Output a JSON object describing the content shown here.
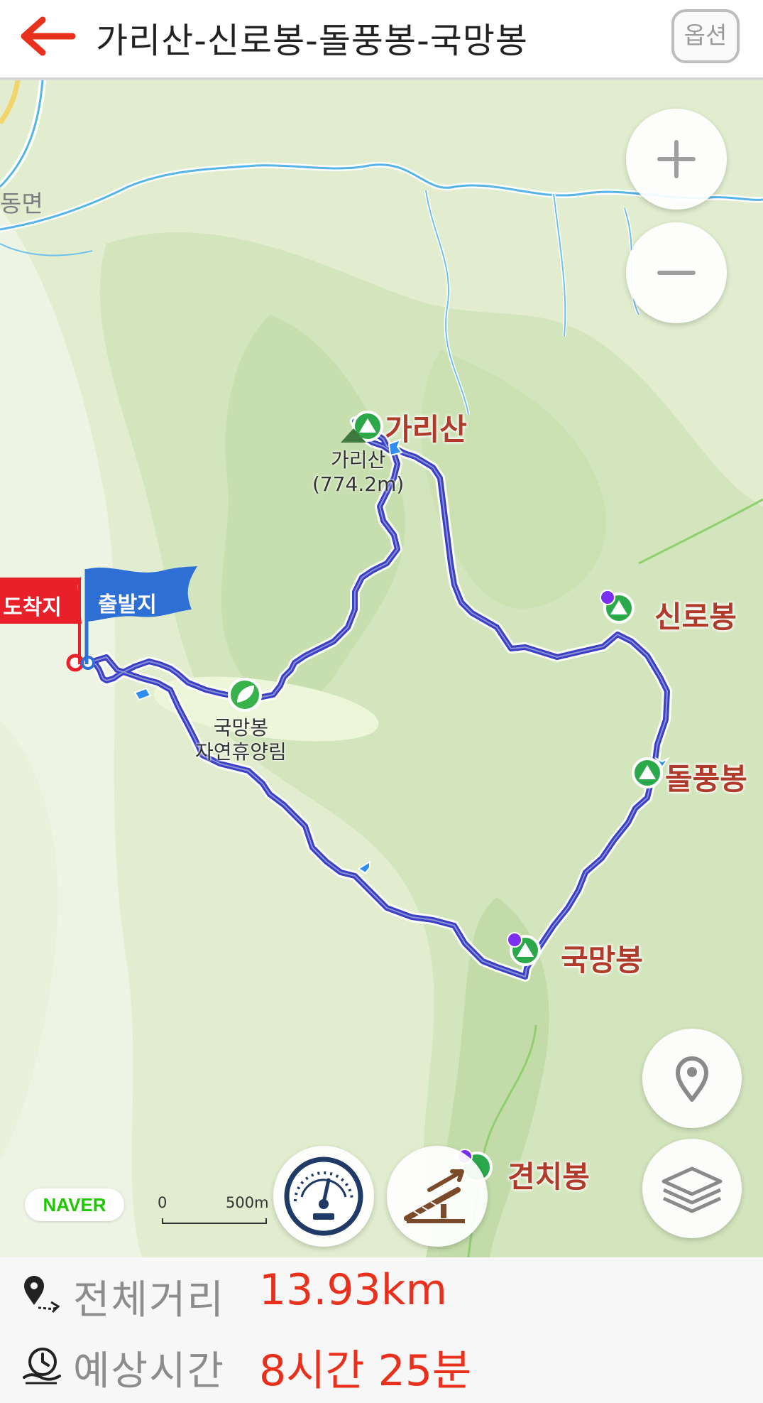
{
  "header": {
    "title": "가리산-신로봉-돌풍봉-국망봉",
    "option_label": "옵션"
  },
  "map": {
    "town_label": "동면",
    "peaks": [
      {
        "label": "가리산"
      },
      {
        "label": "신로봉"
      },
      {
        "label": "돌풍봉"
      },
      {
        "label": "국망봉"
      },
      {
        "label": "견치봉"
      }
    ],
    "summit_name": "가리산",
    "summit_elevation": "(774.2m)",
    "forest_label_line1": "국망봉",
    "forest_label_line2": "자연휴양림",
    "flag_end": "도착지",
    "flag_start": "출발지",
    "logo": "NAVER",
    "scale_start": "0",
    "scale_end": "500m",
    "colors": {
      "route": "#3b3fc6",
      "peak_label": "#b03b2a",
      "flag_end": "#e8202a",
      "flag_start": "#2e6fd6",
      "land": "#dbe9c9",
      "river": "#56b4e8"
    }
  },
  "buttons": {
    "zoom_in": "plus-icon",
    "zoom_out": "minus-icon",
    "locate": "location-pin-icon",
    "layers": "layers-icon",
    "gauge": "speedometer-icon",
    "slope": "slope-icon"
  },
  "info": {
    "distance_label": "전체거리",
    "distance_value": "13.93km",
    "time_label": "예상시간",
    "time_value": "8시간 25분",
    "value_color": "#e8301c"
  }
}
